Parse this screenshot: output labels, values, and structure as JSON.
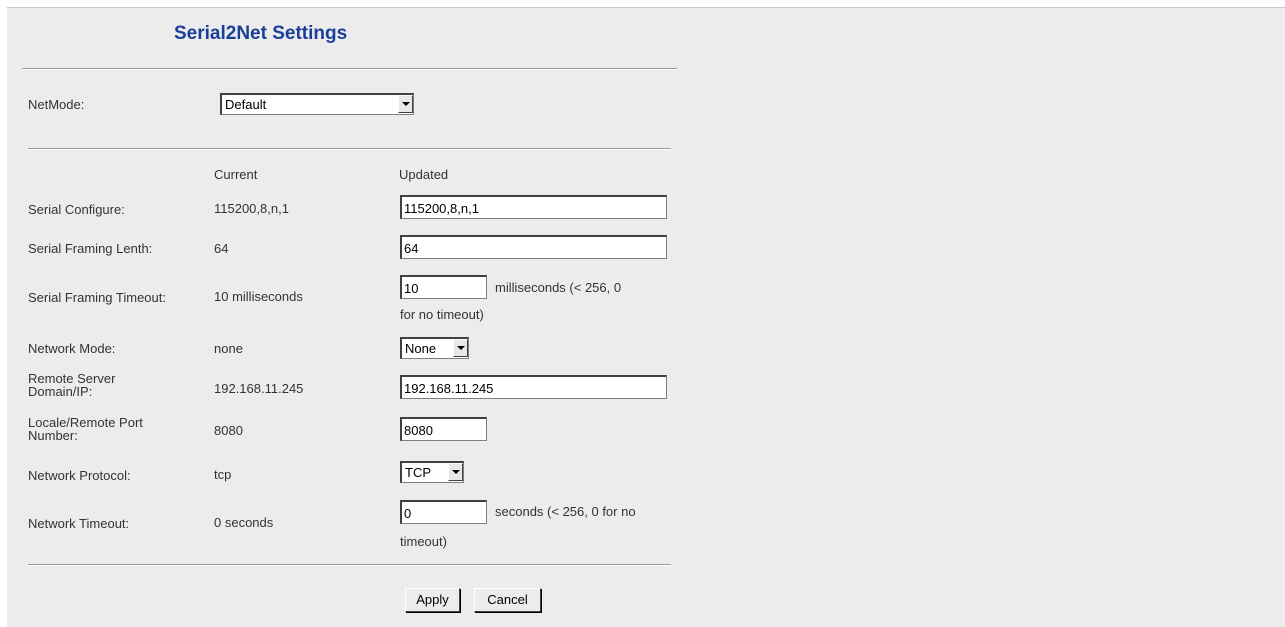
{
  "title": "Serial2Net Settings",
  "netmode": {
    "label": "NetMode:",
    "value": "Default"
  },
  "columns": {
    "current": "Current",
    "updated": "Updated"
  },
  "rows": {
    "serial_configure": {
      "label": "Serial Configure:",
      "current": "115200,8,n,1",
      "value": "115200,8,n,1"
    },
    "framing_length": {
      "label": "Serial Framing Lenth:",
      "current": "64",
      "value": "64"
    },
    "framing_timeout": {
      "label": "Serial Framing Timeout:",
      "current": "10 milliseconds",
      "value": "10",
      "note_1": "milliseconds (< 256, 0",
      "note_2": "for no timeout)"
    },
    "network_mode": {
      "label": "Network Mode:",
      "current": "none",
      "value": "None"
    },
    "remote_server": {
      "label_1": "Remote Server",
      "label_2": "Domain/IP:",
      "current": "192.168.11.245",
      "value": "192.168.11.245"
    },
    "port": {
      "label_1": "Locale/Remote Port",
      "label_2": "Number:",
      "current": "8080",
      "value": "8080"
    },
    "protocol": {
      "label": "Network Protocol:",
      "current": "tcp",
      "value": "TCP"
    },
    "network_timeout": {
      "label": "Network Timeout:",
      "current": "0 seconds",
      "value": "0",
      "note_1": "seconds (< 256, 0 for no",
      "note_2": "timeout)"
    }
  },
  "buttons": {
    "apply": "Apply",
    "cancel": "Cancel"
  }
}
